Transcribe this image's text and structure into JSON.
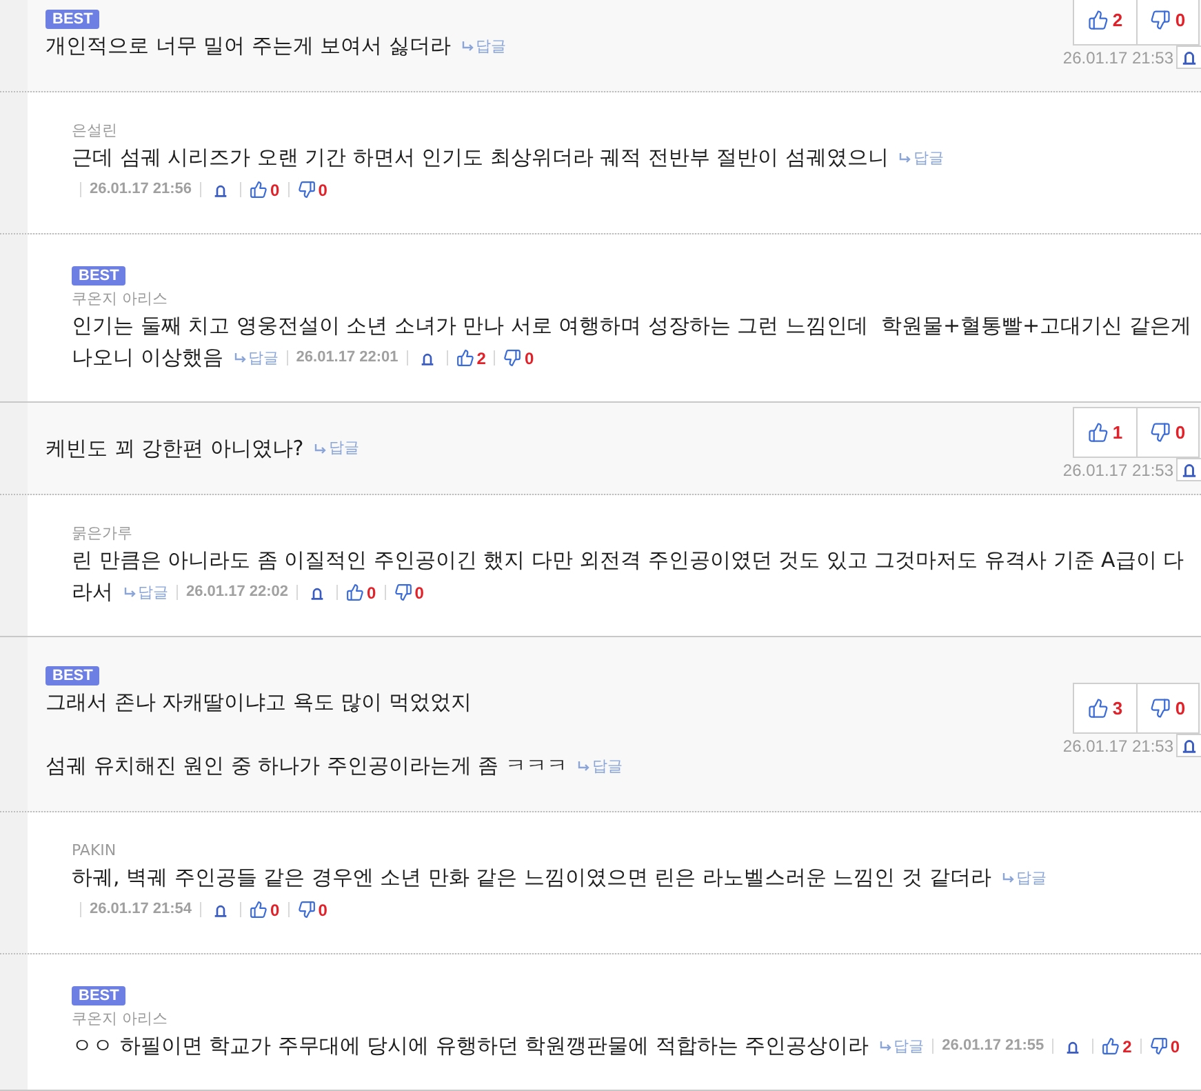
{
  "threads": [
    {
      "comment": {
        "badge": "BEST",
        "text": "개인적으로 너무 밀어 주는게 보여서 싫더라",
        "reply_link": "답글",
        "upvotes": "2",
        "downvotes": "0",
        "date": "26.01.17 21:53"
      },
      "replies": [
        {
          "author": "은설린",
          "text": "근데 섬궤 시리즈가 오랜 기간 하면서 인기도 최상위더라 궤적 전반부 절반이 섬궤였으니",
          "reply_link": "답글",
          "date": "26.01.17 21:56",
          "upvotes": "0",
          "downvotes": "0"
        },
        {
          "badge": "BEST",
          "author": "쿠온지 아리스",
          "text": "인기는 둘째 치고 영웅전설이 소년 소녀가 만나 서로 여행하며 성장하는 그런 느낌인데  학원물+혈통빨+고대기신 같은게 나오니 이상했음",
          "reply_link": "답글",
          "date": "26.01.17 22:01",
          "upvotes": "2",
          "downvotes": "0"
        }
      ]
    },
    {
      "comment": {
        "text": "케빈도 꾀 강한편 아니였나?",
        "reply_link": "답글",
        "upvotes": "1",
        "downvotes": "0",
        "date": "26.01.17 21:53"
      },
      "replies": [
        {
          "author": "묽은가루",
          "text": "린 만큼은 아니라도 좀 이질적인 주인공이긴 했지 다만 외전격 주인공이였던 것도 있고 그것마저도 유격사 기준 A급이 다라서",
          "reply_link": "답글",
          "date": "26.01.17 22:02",
          "upvotes": "0",
          "downvotes": "0"
        }
      ]
    },
    {
      "comment": {
        "badge": "BEST",
        "text": "그래서 존나 자캐딸이냐고 욕도 많이 먹었었지\n\n섬궤 유치해진 원인 중 하나가 주인공이라는게 좀 ㅋㅋㅋ",
        "reply_link": "답글",
        "upvotes": "3",
        "downvotes": "0",
        "date": "26.01.17 21:53"
      },
      "replies": [
        {
          "author": "PAKIN",
          "text": "하궤, 벽궤 주인공들 같은 경우엔 소년 만화 같은 느낌이였으면 린은 라노벨스러운 느낌인 것 같더라",
          "reply_link": "답글",
          "date": "26.01.17 21:54",
          "upvotes": "0",
          "downvotes": "0"
        },
        {
          "badge": "BEST",
          "author": "쿠온지 아리스",
          "text": "ㅇㅇ 하필이면 학교가 주무대에 당시에 유행하던 학원깽판물에 적합하는 주인공상이라",
          "reply_link": "답글",
          "date": "26.01.17 21:55",
          "upvotes": "2",
          "downvotes": "0"
        }
      ]
    }
  ]
}
